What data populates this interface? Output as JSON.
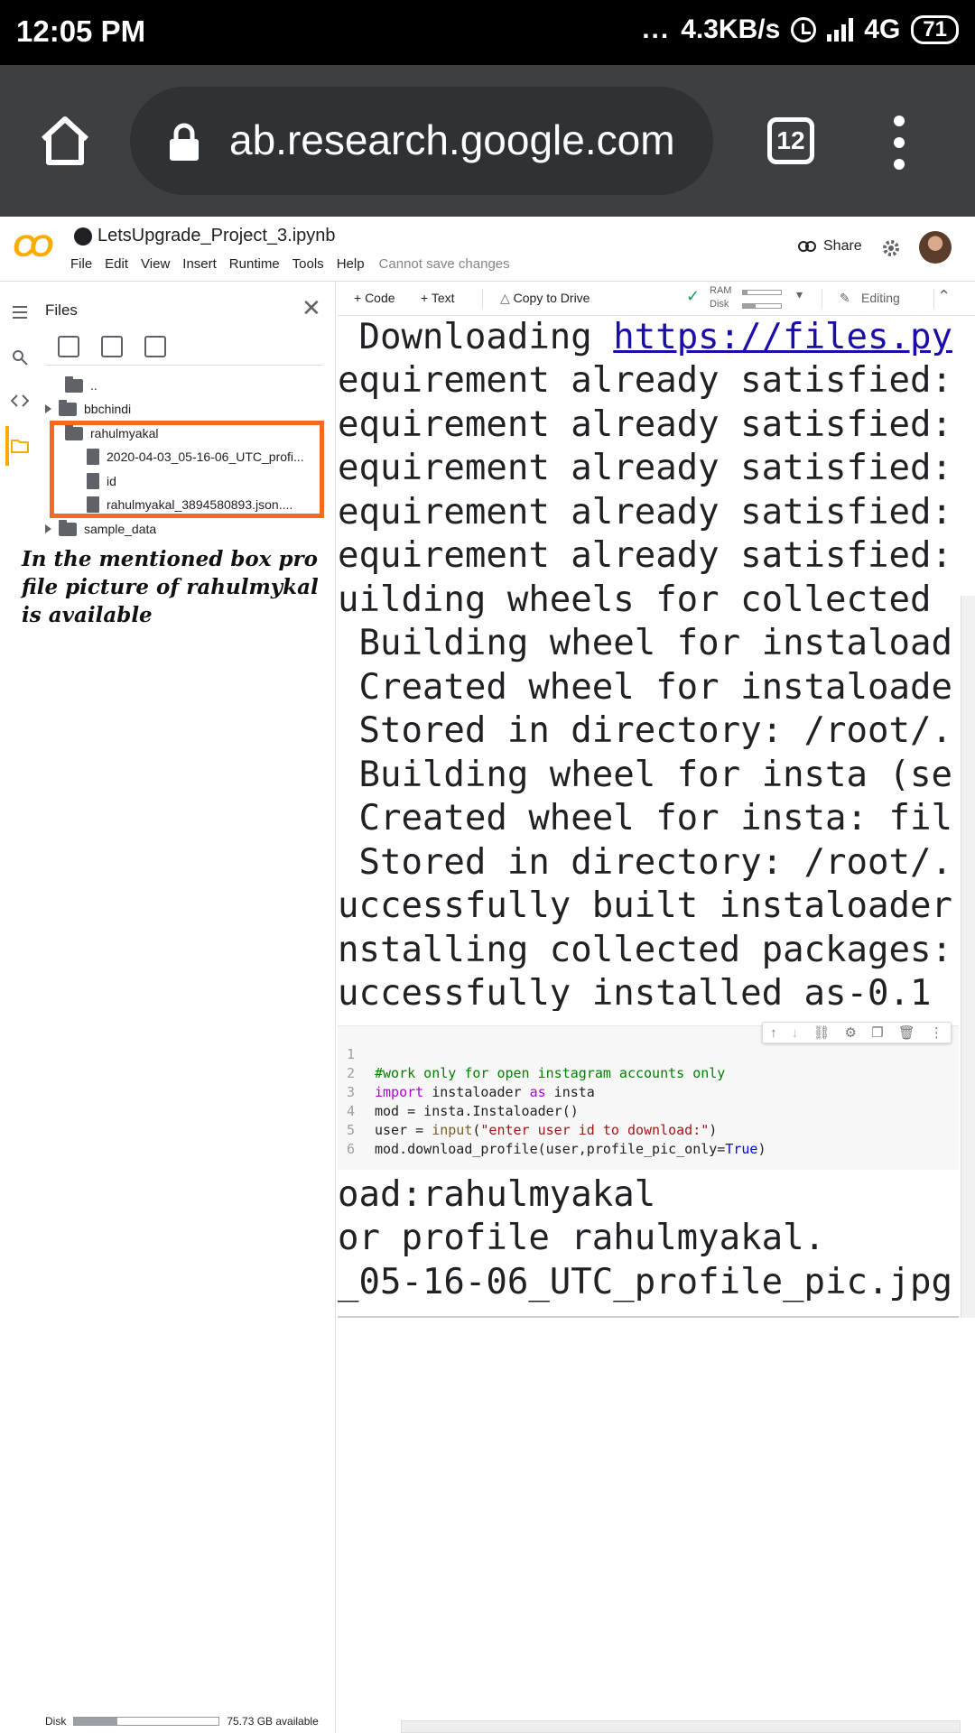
{
  "status_bar": {
    "time": "12:05 PM",
    "dots": "...",
    "net_speed": "4.3KB/s",
    "network": "4G",
    "battery": "71"
  },
  "browser": {
    "url": "ab.research.google.com",
    "tab_count": "12"
  },
  "colab": {
    "logo": "CO",
    "notebook_title": "LetsUpgrade_Project_3.ipynb",
    "menu": [
      "File",
      "Edit",
      "View",
      "Insert",
      "Runtime",
      "Tools",
      "Help"
    ],
    "save_status": "Cannot save changes",
    "share_label": "Share",
    "toolbar": {
      "code": "+ Code",
      "text": "+ Text",
      "copy": "Copy to Drive",
      "ram": "RAM",
      "disk": "Disk",
      "editing": "Editing"
    }
  },
  "files_panel": {
    "title": "Files",
    "tree": [
      {
        "label": "..",
        "type": "up"
      },
      {
        "label": "bbchindi",
        "type": "folder"
      },
      {
        "label": "rahulmyakal",
        "type": "folder"
      },
      {
        "label": "2020-04-03_05-16-06_UTC_profi...",
        "type": "file"
      },
      {
        "label": "id",
        "type": "file"
      },
      {
        "label": "rahulmyakal_3894580893.json....",
        "type": "file"
      },
      {
        "label": "sample_data",
        "type": "folder"
      }
    ],
    "annotation": "In the mentioned box profile picture of rahulmykal is available",
    "disk_label": "Disk",
    "disk_available": "75.73 GB available",
    "disk_used_fraction": 0.3
  },
  "output_top": [
    " Downloading ",
    "equirement already satisfied:",
    "equirement already satisfied:",
    "equirement already satisfied:",
    "equirement already satisfied:",
    "equirement already satisfied:",
    "uilding wheels for collected",
    " Building wheel for instaload",
    " Created wheel for instaloade",
    " Stored in directory: /root/.",
    " Building wheel for insta (se",
    " Created wheel for insta: fil",
    " Stored in directory: /root/.",
    "uccessfully built instaloader",
    "nstalling collected packages:",
    "uccessfully installed as-0.1"
  ],
  "output_link": "https://files.py",
  "code_cell": {
    "line_numbers": [
      "1",
      "2",
      "3",
      "4",
      "5",
      "6"
    ],
    "line2": "#work only for open instagram accounts only",
    "line3_kw1": "import",
    "line3_mid": " instaloader ",
    "line3_kw2": "as",
    "line3_end": " insta",
    "line4": "mod = insta.Instaloader()",
    "line5_start": "user = ",
    "line5_fn": "input",
    "line5_paren1": "(",
    "line5_str": "\"enter user id to download:\"",
    "line5_paren2": ")",
    "line6_start": "mod.download_profile(user,profile_pic_only=",
    "line6_true": "True",
    "line6_end": ")"
  },
  "output_bottom": [
    "oad:rahulmyakal",
    "or profile rahulmyakal.",
    "_05-16-06_UTC_profile_pic.jpg"
  ],
  "colors": {
    "accent": "#f9ab00",
    "highlight_box": "#f26b21",
    "browser_bar": "#3c4043"
  }
}
